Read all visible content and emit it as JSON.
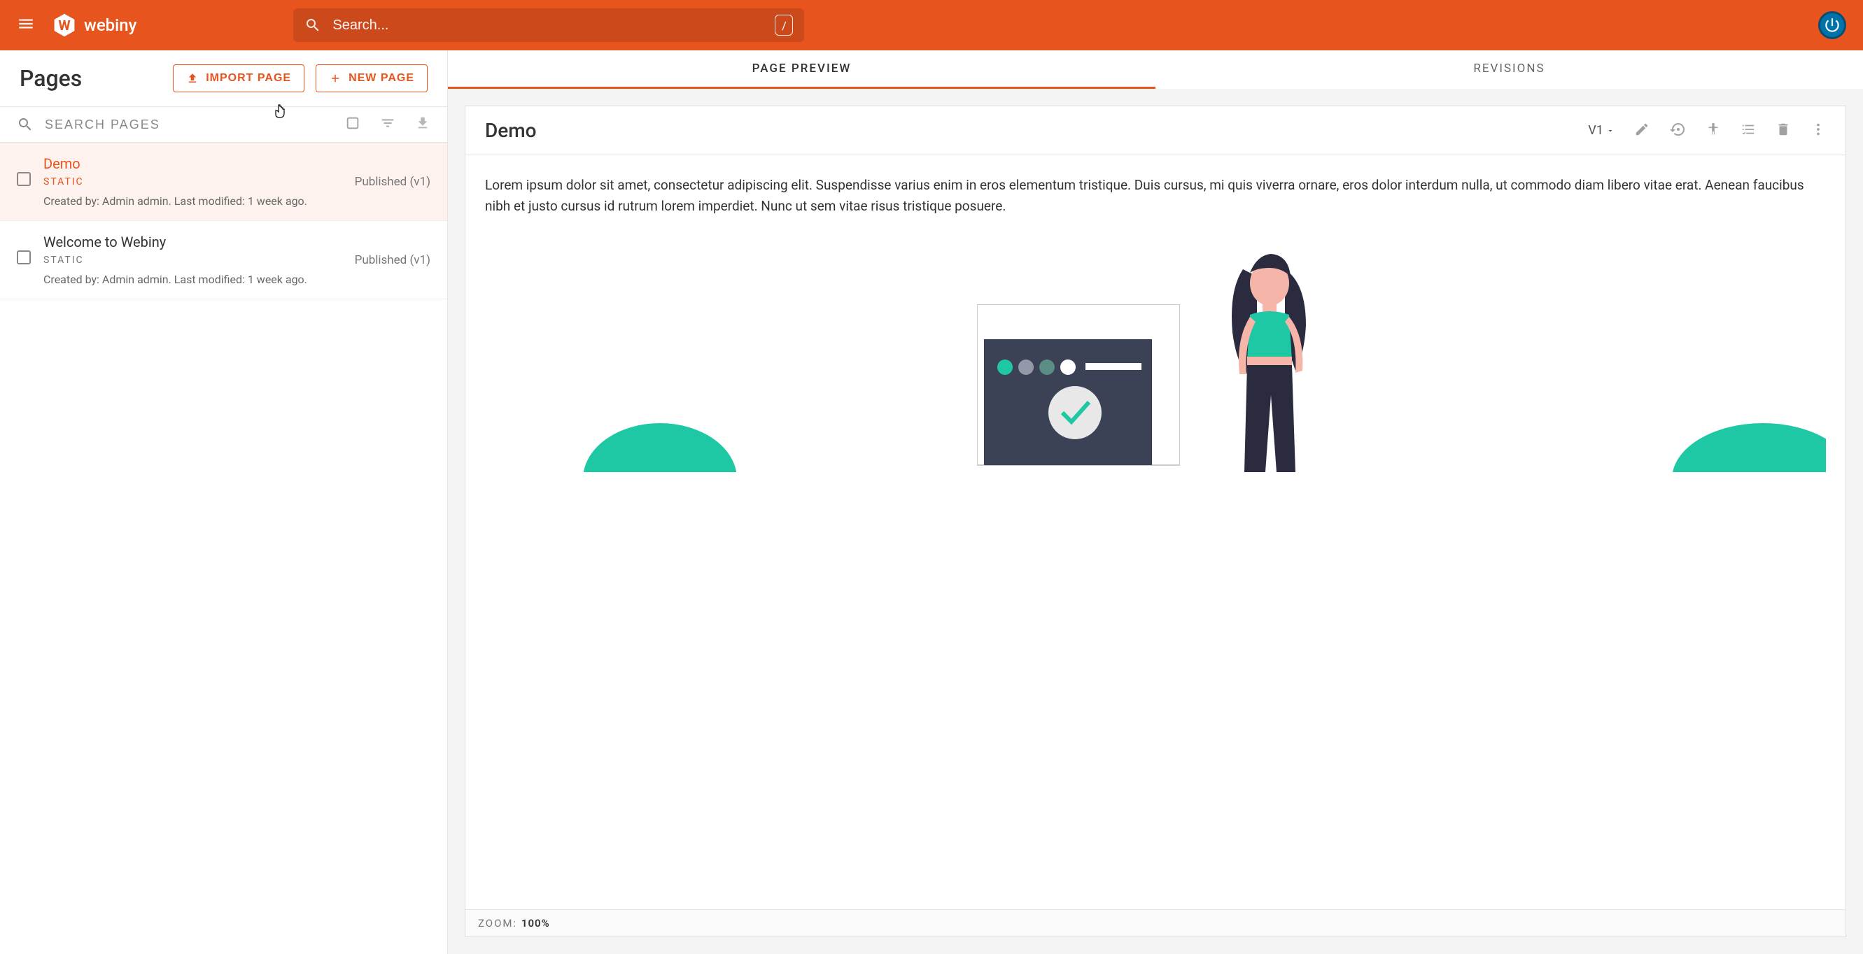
{
  "brand": "webiny",
  "search": {
    "placeholder": "Search...",
    "shortcut": "/"
  },
  "left": {
    "title": "Pages",
    "import_btn": "IMPORT PAGE",
    "new_btn": "NEW PAGE",
    "search_placeholder": "SEARCH PAGES"
  },
  "pages": [
    {
      "name": "Demo",
      "type": "STATIC",
      "meta": "Created by: Admin admin. Last modified: 1 week ago.",
      "status": "Published (v1)",
      "selected": true
    },
    {
      "name": "Welcome to Webiny",
      "type": "STATIC",
      "meta": "Created by: Admin admin. Last modified: 1 week ago.",
      "status": "Published (v1)",
      "selected": false
    }
  ],
  "tabs": {
    "preview": "PAGE PREVIEW",
    "revisions": "REVISIONS"
  },
  "preview": {
    "title": "Demo",
    "version": "V1",
    "body": "Lorem ipsum dolor sit amet, consectetur adipiscing elit. Suspendisse varius enim in eros elementum tristique. Duis cursus, mi quis viverra ornare, eros dolor interdum nulla, ut commodo diam libero vitae erat. Aenean faucibus nibh et justo cursus id rutrum lorem imperdiet. Nunc ut sem vitae risus tristique posuere."
  },
  "zoom": {
    "label": "ZOOM:",
    "value": "100%"
  }
}
